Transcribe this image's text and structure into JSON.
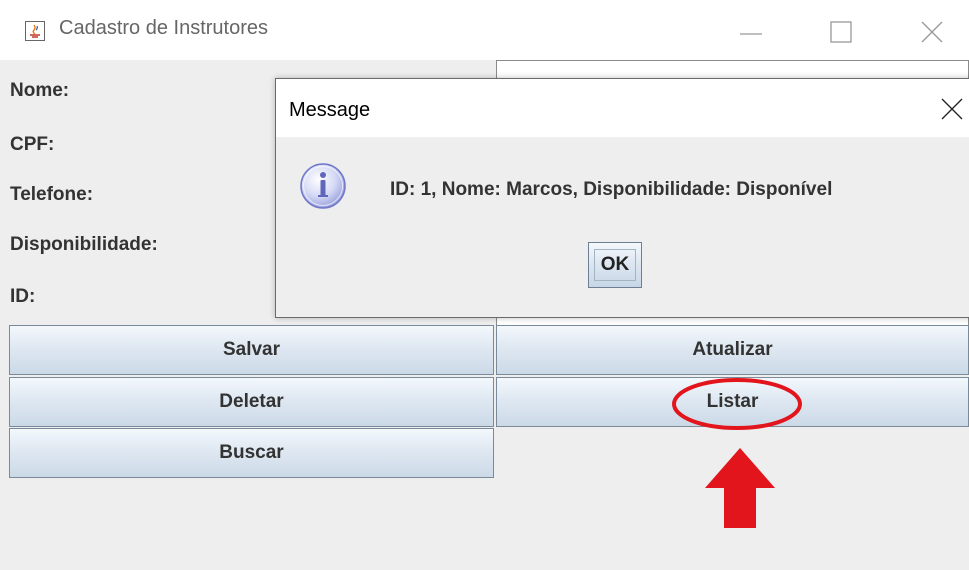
{
  "window": {
    "title": "Cadastro de Instrutores",
    "icon": "java-icon",
    "controls": [
      "minimize-icon",
      "maximize-icon",
      "close-icon"
    ]
  },
  "form": {
    "labels": {
      "nome": "Nome:",
      "cpf": "CPF:",
      "telefone": "Telefone:",
      "disponibilidade": "Disponibilidade:",
      "id": "ID:"
    }
  },
  "buttons": {
    "salvar": "Salvar",
    "atualizar": "Atualizar",
    "deletar": "Deletar",
    "listar": "Listar",
    "buscar": "Buscar"
  },
  "dialog": {
    "title": "Message",
    "icon": "info-icon",
    "message": "ID: 1, Nome: Marcos, Disponibilidade: Disponível",
    "ok_label": "OK"
  },
  "annotation": {
    "ellipse_color": "#e3151c",
    "arrow_color": "#e3151c"
  },
  "colors": {
    "background": "#eeeeee",
    "button_border": "#7a8a99"
  }
}
